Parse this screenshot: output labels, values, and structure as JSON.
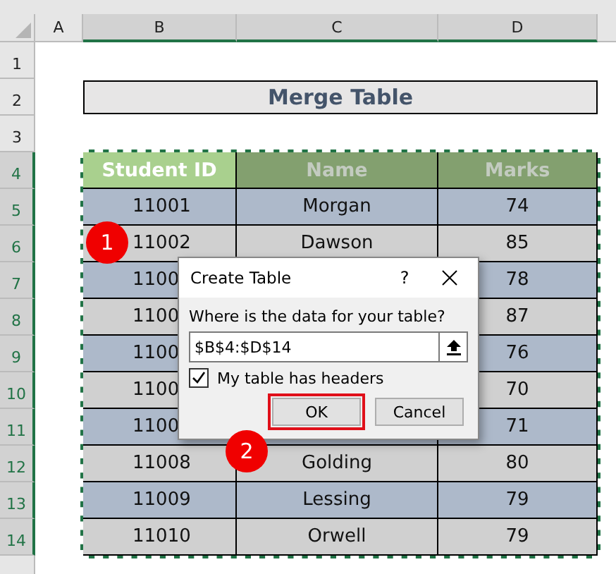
{
  "columns": [
    {
      "label": "A",
      "selected": false
    },
    {
      "label": "B",
      "selected": true
    },
    {
      "label": "C",
      "selected": true
    },
    {
      "label": "D",
      "selected": true
    }
  ],
  "rows": [
    {
      "label": "1",
      "selected": false
    },
    {
      "label": "2",
      "selected": false
    },
    {
      "label": "3",
      "selected": false
    },
    {
      "label": "4",
      "selected": true
    },
    {
      "label": "5",
      "selected": true
    },
    {
      "label": "6",
      "selected": true
    },
    {
      "label": "7",
      "selected": true
    },
    {
      "label": "8",
      "selected": true
    },
    {
      "label": "9",
      "selected": true
    },
    {
      "label": "10",
      "selected": true
    },
    {
      "label": "11",
      "selected": true
    },
    {
      "label": "12",
      "selected": true
    },
    {
      "label": "13",
      "selected": true
    },
    {
      "label": "14",
      "selected": true
    }
  ],
  "title_cell": "Merge Table",
  "table": {
    "headers": [
      "Student ID",
      "Name",
      "Marks"
    ],
    "rows": [
      [
        "11001",
        "Morgan",
        "74"
      ],
      [
        "11002",
        "Dawson",
        "85"
      ],
      [
        "1100",
        "",
        "78"
      ],
      [
        "1100",
        "",
        "87"
      ],
      [
        "1100",
        "",
        "76"
      ],
      [
        "1100",
        "",
        "70"
      ],
      [
        "1100",
        "",
        "71"
      ],
      [
        "11008",
        "Golding",
        "80"
      ],
      [
        "11009",
        "Lessing",
        "79"
      ],
      [
        "11010",
        "Orwell",
        "79"
      ]
    ]
  },
  "dialog": {
    "title": "Create Table",
    "help": "?",
    "prompt": "Where is the data for your table?",
    "range": "$B$4:$D$14",
    "has_headers": {
      "label": "My table has headers",
      "checked": true
    },
    "buttons": [
      {
        "label": "OK",
        "highlighted": true
      },
      {
        "label": "Cancel",
        "highlighted": false
      }
    ]
  },
  "callouts": [
    "1",
    "2"
  ]
}
